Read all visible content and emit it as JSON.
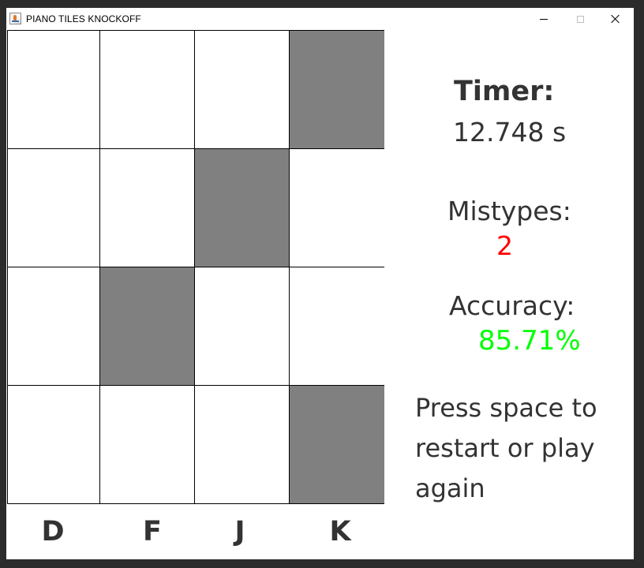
{
  "window": {
    "title": "PIANO TILES KNOCKOFF"
  },
  "board": {
    "rows": [
      [
        false,
        false,
        false,
        true
      ],
      [
        false,
        false,
        true,
        false
      ],
      [
        false,
        true,
        false,
        false
      ],
      [
        false,
        false,
        false,
        true
      ]
    ],
    "keys": [
      "D",
      "F",
      "J",
      "K"
    ]
  },
  "stats": {
    "timer_label": "Timer:",
    "timer_value": "12.748 s",
    "mistypes_label": "Mistypes:",
    "mistypes_value": "2",
    "accuracy_label": "Accuracy:",
    "accuracy_value": "85.71%",
    "message": "Press space to restart or play again"
  },
  "colors": {
    "dark_tile": "#808080",
    "light_tile": "#ffffff",
    "text": "#333333",
    "mistypes": "#ff0000",
    "accuracy": "#00ff00"
  }
}
